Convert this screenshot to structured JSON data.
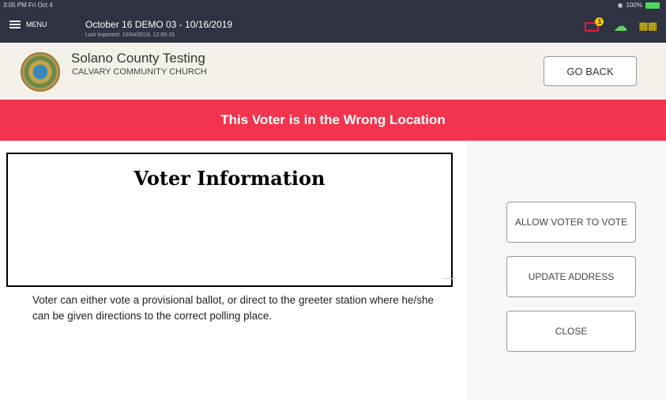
{
  "status_bar": {
    "time": "3:05 PM  Fri Oct 4",
    "battery": "100%"
  },
  "header": {
    "menu_label": "MENU",
    "event_title": "October 16 DEMO 03 - 10/16/2019",
    "event_subtitle": "Last Imported: 10/04/2019, 12:55:15",
    "printer_badge": "1",
    "icons": [
      "printer-icon",
      "cloud-upload-icon",
      "network-icon"
    ]
  },
  "location": {
    "county": "Solano County Testing",
    "site": "CALVARY COMMUNITY CHURCH",
    "go_back_label": "GO BACK"
  },
  "alert": {
    "text": "This Voter is in the Wrong Location",
    "color": "#f2344e"
  },
  "voter_info": {
    "title": "Voter Information"
  },
  "actions": {
    "allow_label": "ALLOW VOTER TO VOTE",
    "update_label": "UPDATE ADDRESS",
    "close_label": "CLOSE"
  },
  "message": "Voter can either vote a provisional ballot, or direct to the greeter station where he/she can be given directions to the correct polling place."
}
